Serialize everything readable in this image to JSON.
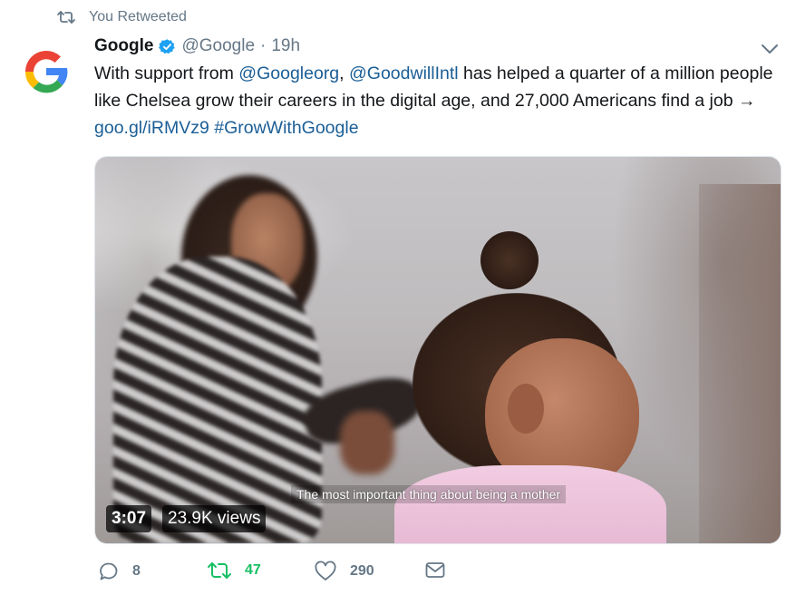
{
  "retweet_context": {
    "label": "You Retweeted"
  },
  "author": {
    "name": "Google",
    "handle": "@Google",
    "separator": "·",
    "time": "19h",
    "verified": true,
    "avatar_icon": "google-g-logo"
  },
  "tweet": {
    "text_parts": {
      "p1": "With support from ",
      "mention1": "@Googleorg",
      "p2": ", ",
      "mention2": "@GoodwillIntl",
      "p3": " has helped a quarter of a million people like Chelsea grow their careers in the digital age, and 27,000 Americans find a job → ",
      "link": "goo.gl/iRMVz9",
      "p4": " ",
      "hashtag": "#GrowWithGoogle"
    }
  },
  "media": {
    "caption": "The most important thing about being a mother",
    "duration": "3:07",
    "views": "23.9K views"
  },
  "actions": {
    "reply_count": "8",
    "retweet_count": "47",
    "like_count": "290"
  },
  "colors": {
    "link": "#1b5e96",
    "retweet_active": "#17bf63",
    "verified": "#1da1f2",
    "muted": "#657786"
  },
  "icons": {
    "retweet_context": "retweet-icon",
    "verified": "verified-badge-icon",
    "menu": "chevron-down-icon",
    "reply": "reply-icon",
    "retweet": "retweet-icon",
    "like": "heart-icon",
    "dm": "envelope-icon"
  }
}
